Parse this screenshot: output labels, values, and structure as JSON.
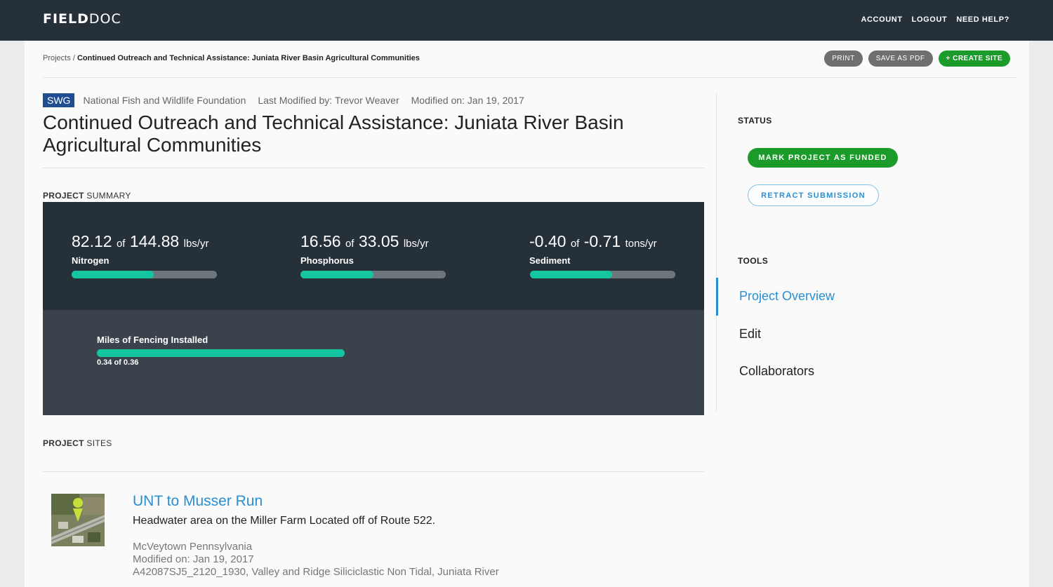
{
  "app": {
    "logo_bold": "FIELD",
    "logo_light": "DOC"
  },
  "topnav": [
    "ACCOUNT",
    "LOGOUT",
    "NEED HELP?"
  ],
  "breadcrumb": {
    "root": "Projects",
    "separator": "/",
    "current": "Continued Outreach and Technical Assistance: Juniata River Basin Agricultural Communities"
  },
  "actions": {
    "print": "PRINT",
    "save_pdf": "SAVE AS PDF",
    "create_site": "+ CREATE SITE"
  },
  "project": {
    "badge": "SWG",
    "organization": "National Fish and Wildlife Foundation",
    "last_modified_by": "Last Modified by: Trevor Weaver",
    "modified_on": "Modified on: Jan 19, 2017",
    "title": "Continued Outreach and Technical Assistance: Juniata River Basin Agricultural Communities"
  },
  "summary": {
    "label_bold": "PROJECT",
    "label_rest": " SUMMARY",
    "of_word": "of",
    "metrics": [
      {
        "value": "82.12",
        "target": "144.88",
        "unit": "lbs/yr",
        "name": "Nitrogen",
        "progress": 0.567
      },
      {
        "value": "16.56",
        "target": "33.05",
        "unit": "lbs/yr",
        "name": "Phosphorus",
        "progress": 0.501
      },
      {
        "value": "-0.40",
        "target": "-0.71",
        "unit": "tons/yr",
        "name": "Sediment",
        "progress": 0.563
      }
    ],
    "fencing": {
      "label": "Miles of Fencing Installed",
      "value_text": "0.34 of 0.36",
      "progress": 1.0
    }
  },
  "sites": {
    "label_bold": "PROJECT",
    "label_rest": " SITES",
    "items": [
      {
        "name": "UNT to Musser Run",
        "description": "Headwater area on the Miller Farm Located off of Route 522.",
        "location": "McVeytown Pennsylvania",
        "modified": "Modified on: Jan 19, 2017",
        "segment": "A42087SJ5_2120_1930, Valley and Ridge Siliciclastic Non Tidal, Juniata River"
      }
    ]
  },
  "sidebar": {
    "status_label": "STATUS",
    "funded_button": "MARK PROJECT AS FUNDED",
    "retract_button": "RETRACT SUBMISSION",
    "tools_label": "TOOLS",
    "tools": [
      "Project Overview",
      "Edit",
      "Collaborators"
    ]
  },
  "colors": {
    "navbar": "#263039",
    "accent_green": "#1a9b2a",
    "progress_teal": "#13c6a0",
    "link_blue": "#2a8fd1",
    "badge_blue": "#1f4e93"
  }
}
